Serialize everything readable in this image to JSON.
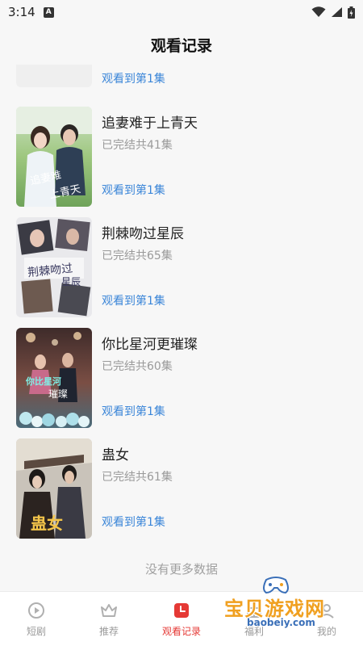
{
  "status_bar": {
    "time": "3:14",
    "notification_letter": "A"
  },
  "header": {
    "title": "观看记录"
  },
  "list": {
    "partial_item": {
      "progress": "观看到第1集"
    },
    "items": [
      {
        "title": "追妻难于上青天",
        "status": "已完结共41集",
        "progress": "观看到第1集"
      },
      {
        "title": "荆棘吻过星辰",
        "status": "已完结共65集",
        "progress": "观看到第1集"
      },
      {
        "title": "你比星河更璀璨",
        "status": "已完结共60集",
        "progress": "观看到第1集"
      },
      {
        "title": "蛊女",
        "status": "已完结共61集",
        "progress": "观看到第1集"
      }
    ],
    "end_text": "没有更多数据"
  },
  "bottom_nav": {
    "items": [
      {
        "label": "短剧",
        "icon": "play-circle-icon"
      },
      {
        "label": "推荐",
        "icon": "crown-icon"
      },
      {
        "label": "观看记录",
        "icon": "history-icon",
        "active": true
      },
      {
        "label": "福利",
        "icon": "gift-icon"
      },
      {
        "label": "我的",
        "icon": "user-icon"
      }
    ]
  },
  "watermark": {
    "name": "宝贝游戏网",
    "url": "baobeiy.com"
  },
  "colors": {
    "accent": "#e53935",
    "link": "#3b86d8",
    "muted": "#9a9a9a"
  }
}
